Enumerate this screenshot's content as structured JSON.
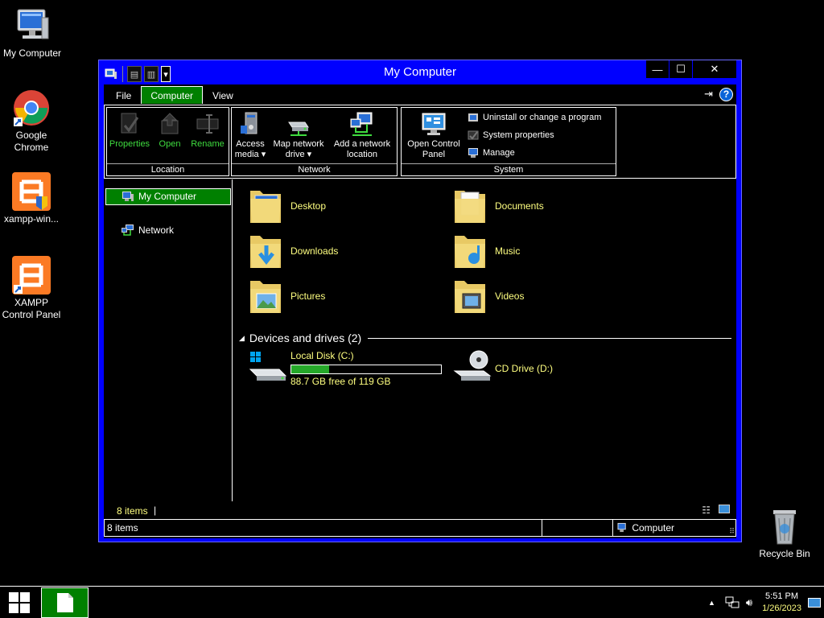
{
  "desktop": {
    "icons": [
      {
        "label": "My Computer",
        "icon": "computer-icon"
      },
      {
        "label": "Google Chrome",
        "icon": "chrome-icon"
      },
      {
        "label": "xampp-win...",
        "icon": "xampp-icon"
      },
      {
        "label": "XAMPP Control Panel",
        "icon": "xampp-icon"
      },
      {
        "label": "Recycle Bin",
        "icon": "recycle-bin-icon"
      }
    ]
  },
  "window": {
    "title": "My Computer",
    "controls": {
      "minimize": "—",
      "maximize": "☐",
      "close": "✕"
    },
    "tabs": [
      {
        "label": "File"
      },
      {
        "label": "Computer",
        "active": true
      },
      {
        "label": "View"
      }
    ],
    "ribbon": {
      "location": {
        "name": "Location",
        "buttons": [
          {
            "label": "Properties",
            "icon": "properties-icon"
          },
          {
            "label": "Open",
            "icon": "open-icon"
          },
          {
            "label": "Rename",
            "icon": "rename-icon"
          }
        ]
      },
      "network": {
        "name": "Network",
        "buttons": [
          {
            "line1": "Access",
            "line2": "media ▾",
            "icon": "access-media-icon"
          },
          {
            "line1": "Map network",
            "line2": "drive ▾",
            "icon": "map-network-drive-icon"
          },
          {
            "line1": "Add a network",
            "line2": "location",
            "icon": "add-network-location-icon"
          }
        ]
      },
      "system": {
        "name": "System",
        "big_button": {
          "line1": "Open Control",
          "line2": "Panel",
          "icon": "control-panel-icon"
        },
        "small_buttons": [
          {
            "label": "Uninstall or change a program",
            "icon": "uninstall-icon"
          },
          {
            "label": "System properties",
            "icon": "system-properties-icon"
          },
          {
            "label": "Manage",
            "icon": "manage-icon"
          }
        ]
      }
    },
    "nav": {
      "items": [
        {
          "label": "My Computer",
          "selected": true,
          "icon": "computer-icon"
        },
        {
          "label": "Network",
          "selected": false,
          "icon": "network-icon"
        }
      ]
    },
    "folders": [
      {
        "label": "Desktop",
        "icon": "desktop-folder-icon"
      },
      {
        "label": "Documents",
        "icon": "documents-folder-icon"
      },
      {
        "label": "Downloads",
        "icon": "downloads-folder-icon"
      },
      {
        "label": "Music",
        "icon": "music-folder-icon"
      },
      {
        "label": "Pictures",
        "icon": "pictures-folder-icon"
      },
      {
        "label": "Videos",
        "icon": "videos-folder-icon"
      }
    ],
    "devices": {
      "header": "Devices and drives (2)",
      "drives": [
        {
          "label": "Local Disk (C:)",
          "free_text": "88.7 GB free of 119 GB",
          "used_fraction": 0.255,
          "icon": "hard-drive-icon"
        },
        {
          "label": "CD Drive (D:)",
          "icon": "cd-drive-icon"
        }
      ]
    },
    "status_top": {
      "count": "8 items"
    },
    "status_bar": {
      "count": "8 items",
      "location": "Computer"
    }
  },
  "taskbar": {
    "time": "5:51 PM",
    "date": "1/26/2023",
    "tray_icons": [
      "show-hidden-icon",
      "network-icon",
      "volume-icon",
      "desktop-icon"
    ]
  },
  "colors": {
    "window_border": "#0000ff",
    "highlight": "#008000",
    "text_accent": "#ffff80",
    "ribbon_green_text": "#3fdc3f"
  }
}
